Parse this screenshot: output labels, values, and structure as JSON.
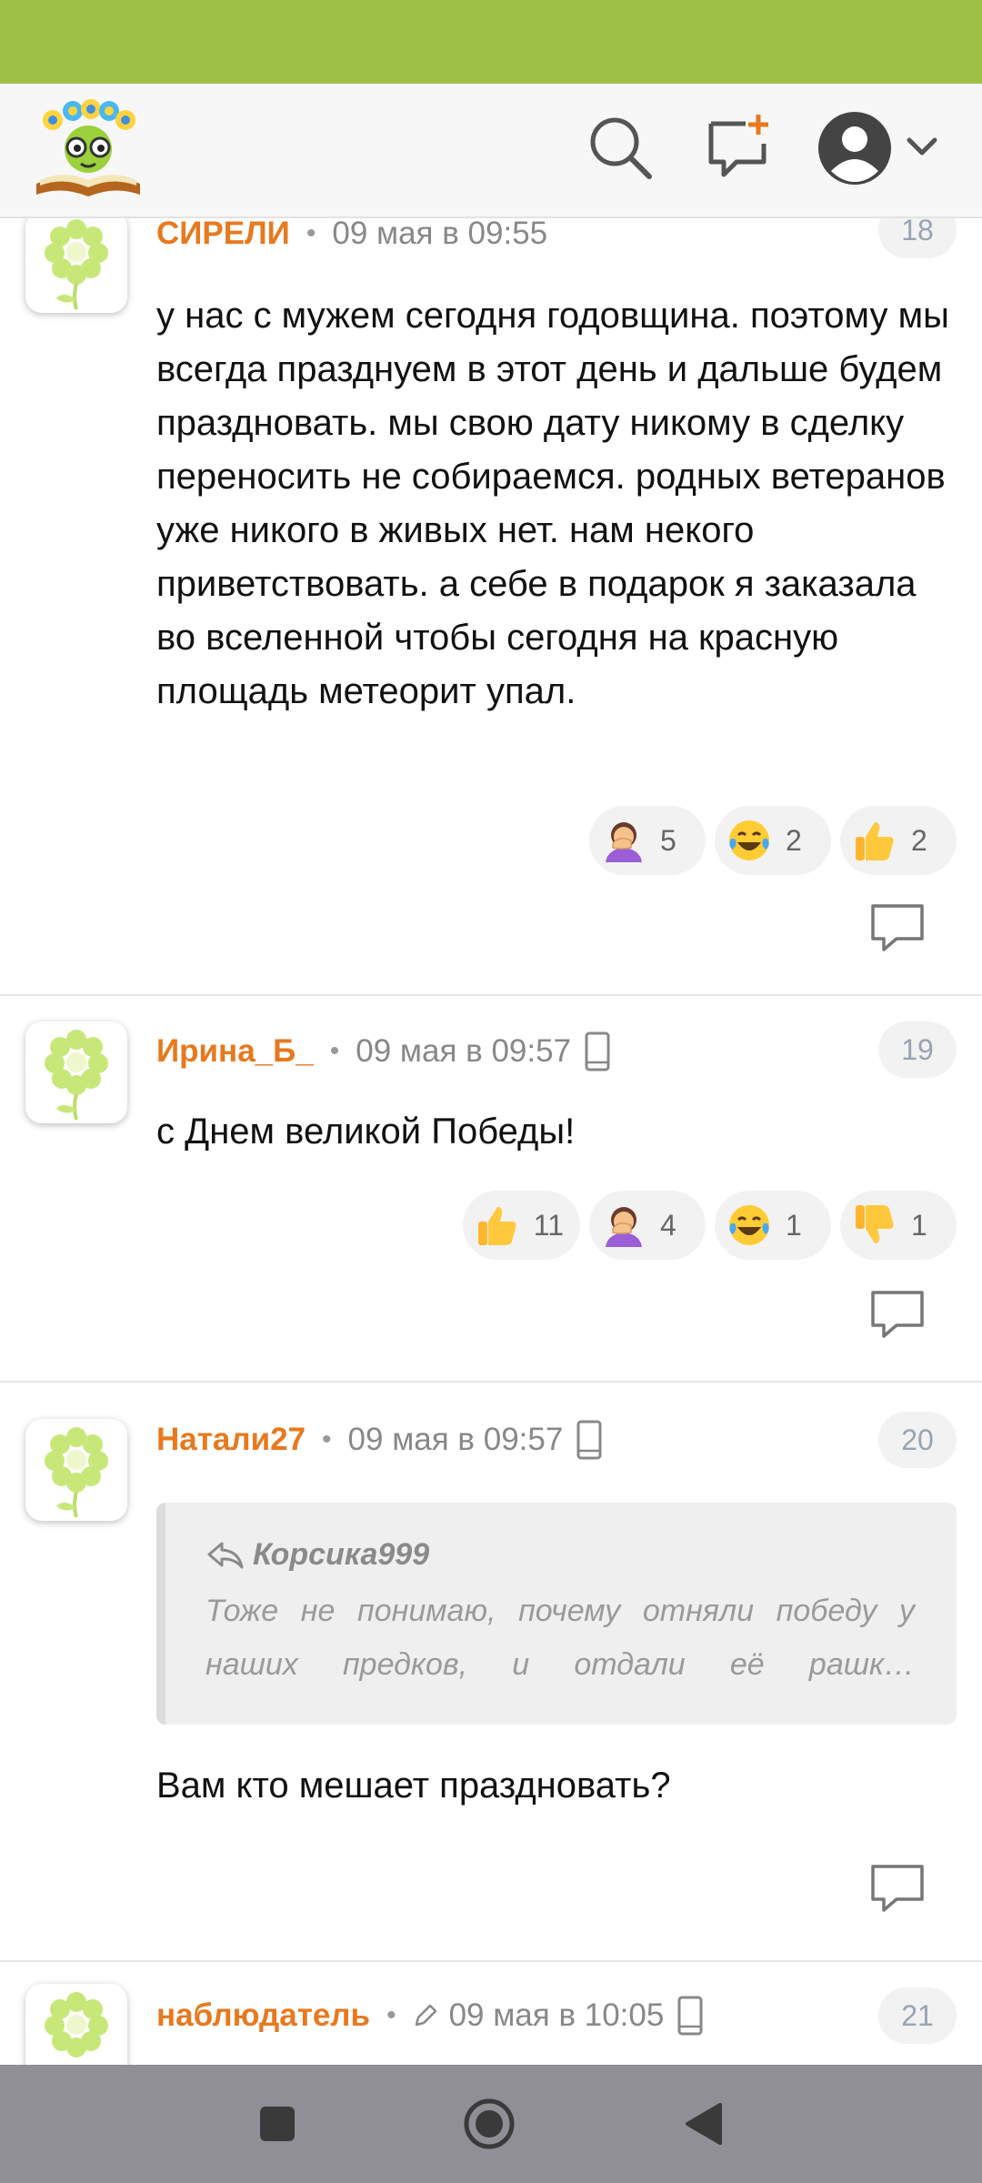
{
  "header": {
    "logo": "flower-reader-logo",
    "icons": [
      "search-icon",
      "new-topic-icon",
      "user-avatar-icon",
      "chevron-down-icon"
    ]
  },
  "comments": [
    {
      "author": "СИРЕЛИ",
      "time": "09 мая в 09:55",
      "number": "18",
      "text": "у нас с мужем сегодня годовщина. поэтому мы всегда празднуем в этот день и дальше будем праздновать. мы свою дату никому в сделку переносить не собираемся. родных ветеранов уже никого в живых нет. нам некого приветствовать. а себе в подарок я заказала во вселенной чтобы сегодня на красную площадь метеорит упал.",
      "reactions": [
        {
          "emoji": "facepalm",
          "count": "5"
        },
        {
          "emoji": "laughing-tears",
          "count": "2"
        },
        {
          "emoji": "thumbs-up",
          "count": "2"
        }
      ]
    },
    {
      "author": "Ирина_Б_",
      "time": "09 мая в 09:57",
      "number": "19",
      "text": "с Днем великой Победы!",
      "reactions": [
        {
          "emoji": "thumbs-up",
          "count": "11"
        },
        {
          "emoji": "facepalm",
          "count": "4"
        },
        {
          "emoji": "laughing-tears",
          "count": "1"
        },
        {
          "emoji": "thumbs-down",
          "count": "1"
        }
      ]
    },
    {
      "author": "Натали27",
      "time": "09 мая в 09:57",
      "number": "20",
      "quote": {
        "author": "Корсика999",
        "text": "Тоже не понимаю, почему отняли победу у наших предков, и отдали её рашк…"
      },
      "text": "Вам кто мешает праздновать?"
    },
    {
      "author": "наблюдатель",
      "time": "09 мая в 10:05",
      "number": "21"
    }
  ],
  "colors": {
    "status_bar": "#9dc145",
    "author": "#e7791e",
    "nav_bar": "#8f8f95"
  }
}
